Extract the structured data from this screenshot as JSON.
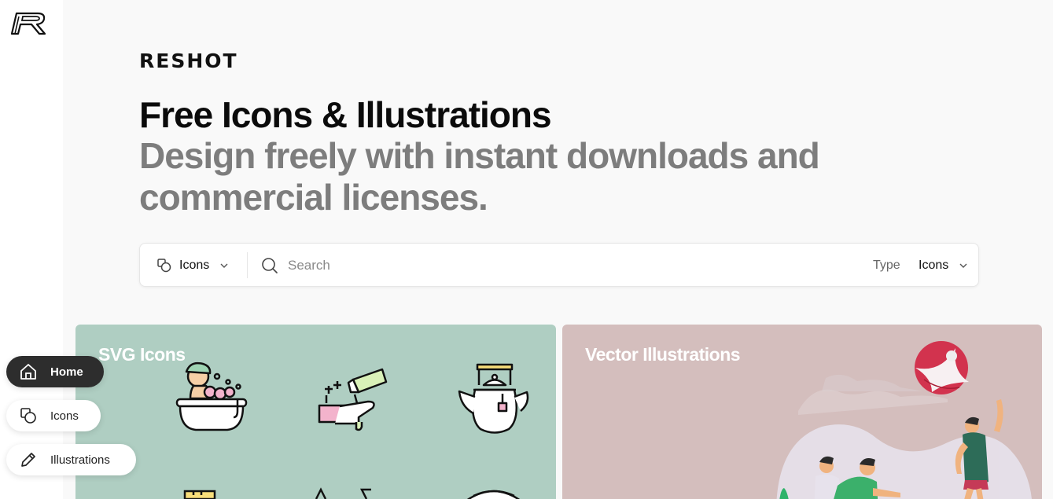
{
  "brand": {
    "wordmark": "RESHOT"
  },
  "hero": {
    "title": "Free Icons & Illustrations",
    "subtitle": "Design freely with instant downloads and commercial licenses."
  },
  "search": {
    "asset_type": "Icons",
    "placeholder": "Search",
    "type_label": "Type",
    "type_value": "Icons"
  },
  "cards": [
    {
      "title": "SVG Icons"
    },
    {
      "title": "Vector Illustrations"
    }
  ],
  "nav": [
    {
      "label": "Home",
      "icon": "home-icon"
    },
    {
      "label": "Icons",
      "icon": "shapes-icon"
    },
    {
      "label": "Illustrations",
      "icon": "pencil-icon"
    }
  ],
  "colors": {
    "icons_card": "#afcec2",
    "illustrations_card": "#d4bebd",
    "active_nav": "#2d2d2d"
  }
}
